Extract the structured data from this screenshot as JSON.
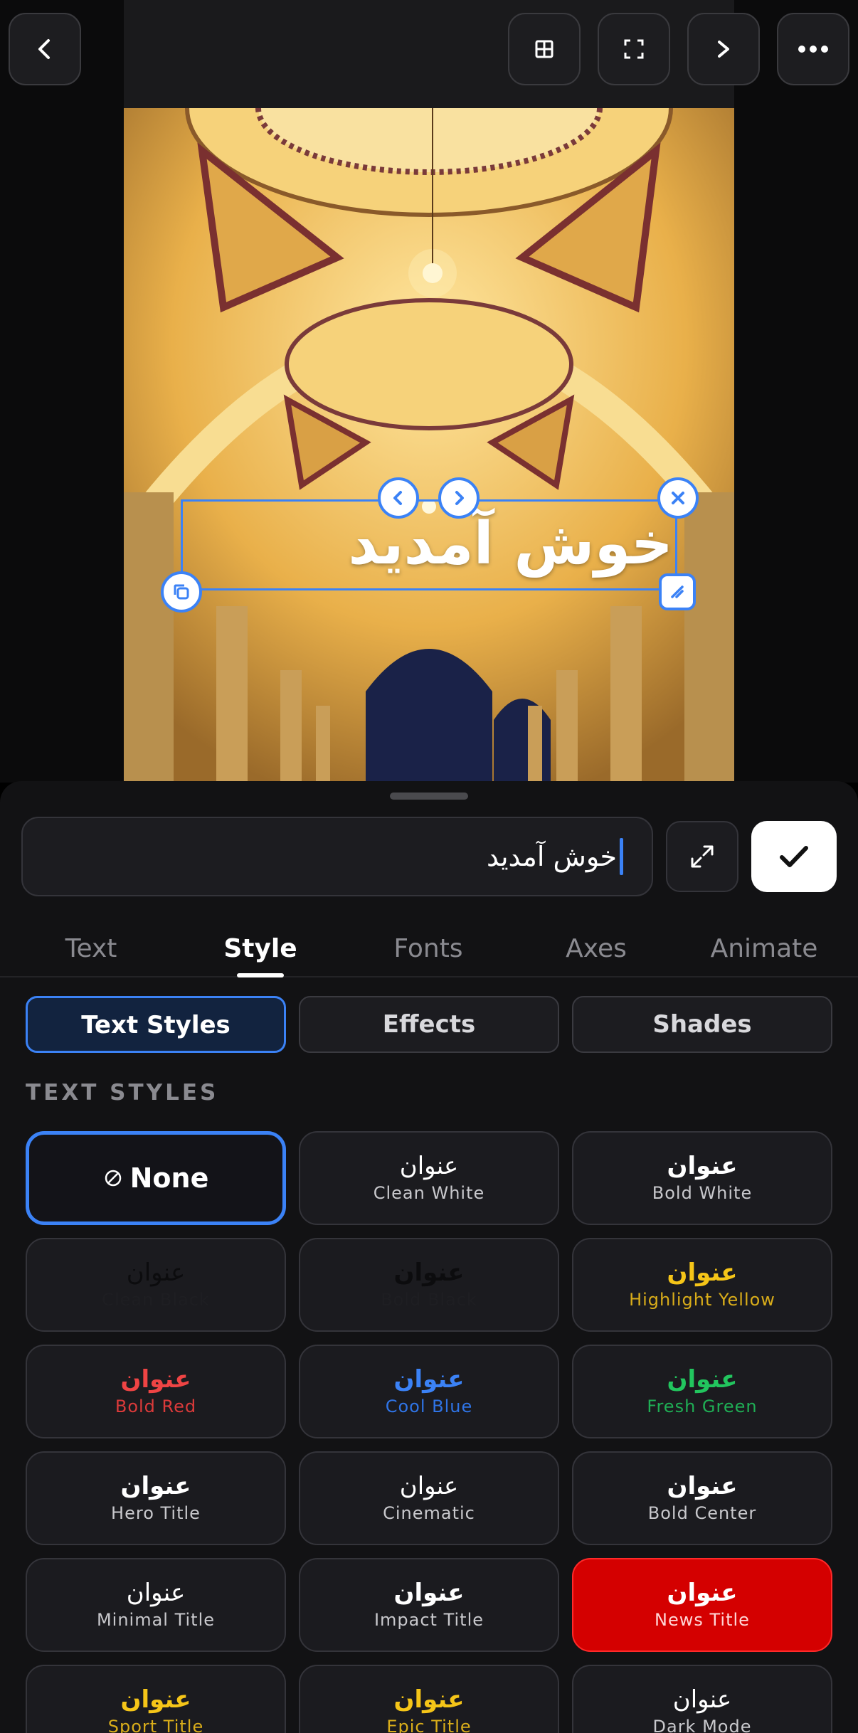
{
  "canvas": {
    "overlay_text": "خوش آمدید"
  },
  "editor": {
    "input_value": "خوش آمدید"
  },
  "tabs": [
    {
      "label": "Text"
    },
    {
      "label": "Style"
    },
    {
      "label": "Fonts"
    },
    {
      "label": "Axes"
    },
    {
      "label": "Animate"
    }
  ],
  "segments": [
    {
      "label": "Text Styles"
    },
    {
      "label": "Effects"
    },
    {
      "label": "Shades"
    }
  ],
  "section_label": "TEXT STYLES",
  "styles": [
    {
      "ar": "",
      "en": "None",
      "selected": true
    },
    {
      "ar": "عنوان",
      "en": "Clean White",
      "color": "#ffffff",
      "sub": "#c8c8cc"
    },
    {
      "ar": "عنوان",
      "en": "Bold White",
      "color": "#ffffff",
      "sub": "#c8c8cc",
      "bold": true
    },
    {
      "ar": "عنوان",
      "en": "Clean Black",
      "color": "#0c0c0e",
      "sub": "#1e1e22"
    },
    {
      "ar": "عنوان",
      "en": "Bold Black",
      "color": "#0c0c0e",
      "sub": "#1e1e22",
      "bold": true
    },
    {
      "ar": "عنوان",
      "en": "Highlight Yellow",
      "color": "#f5c518",
      "sub": "#d9ad1a",
      "bold": true
    },
    {
      "ar": "عنوان",
      "en": "Bold Red",
      "color": "#ef4444",
      "sub": "#dc3a3a",
      "bold": true
    },
    {
      "ar": "عنوان",
      "en": "Cool Blue",
      "color": "#3b82f6",
      "sub": "#2f74e6",
      "bold": true
    },
    {
      "ar": "عنوان",
      "en": "Fresh Green",
      "color": "#22c55e",
      "sub": "#1fae55",
      "bold": true
    },
    {
      "ar": "عنوان",
      "en": "Hero Title",
      "color": "#ffffff",
      "sub": "#c8c8cc",
      "bold": true
    },
    {
      "ar": "عنوان",
      "en": "Cinematic",
      "color": "#ffffff",
      "sub": "#c8c8cc"
    },
    {
      "ar": "عنوان",
      "en": "Bold Center",
      "color": "#ffffff",
      "sub": "#c8c8cc",
      "bold": true
    },
    {
      "ar": "عنوان",
      "en": "Minimal Title",
      "color": "#ffffff",
      "sub": "#c8c8cc"
    },
    {
      "ar": "عنوان",
      "en": "Impact Title",
      "color": "#ffffff",
      "sub": "#c8c8cc",
      "bold": true
    },
    {
      "ar": "عنوان",
      "en": "News Title",
      "color": "#ffffff",
      "sub": "#ffd6d6",
      "bold": true,
      "bg": "#d40000"
    },
    {
      "ar": "عنوان",
      "en": "Sport Title",
      "color": "#f5c518",
      "sub": "#d9ad1a",
      "bold": true
    },
    {
      "ar": "عنوان",
      "en": "Epic Title",
      "color": "#f5c518",
      "sub": "#d9ad1a",
      "bold": true
    },
    {
      "ar": "عنوان",
      "en": "Dark Mode",
      "color": "#ffffff",
      "sub": "#c8c8cc"
    }
  ]
}
